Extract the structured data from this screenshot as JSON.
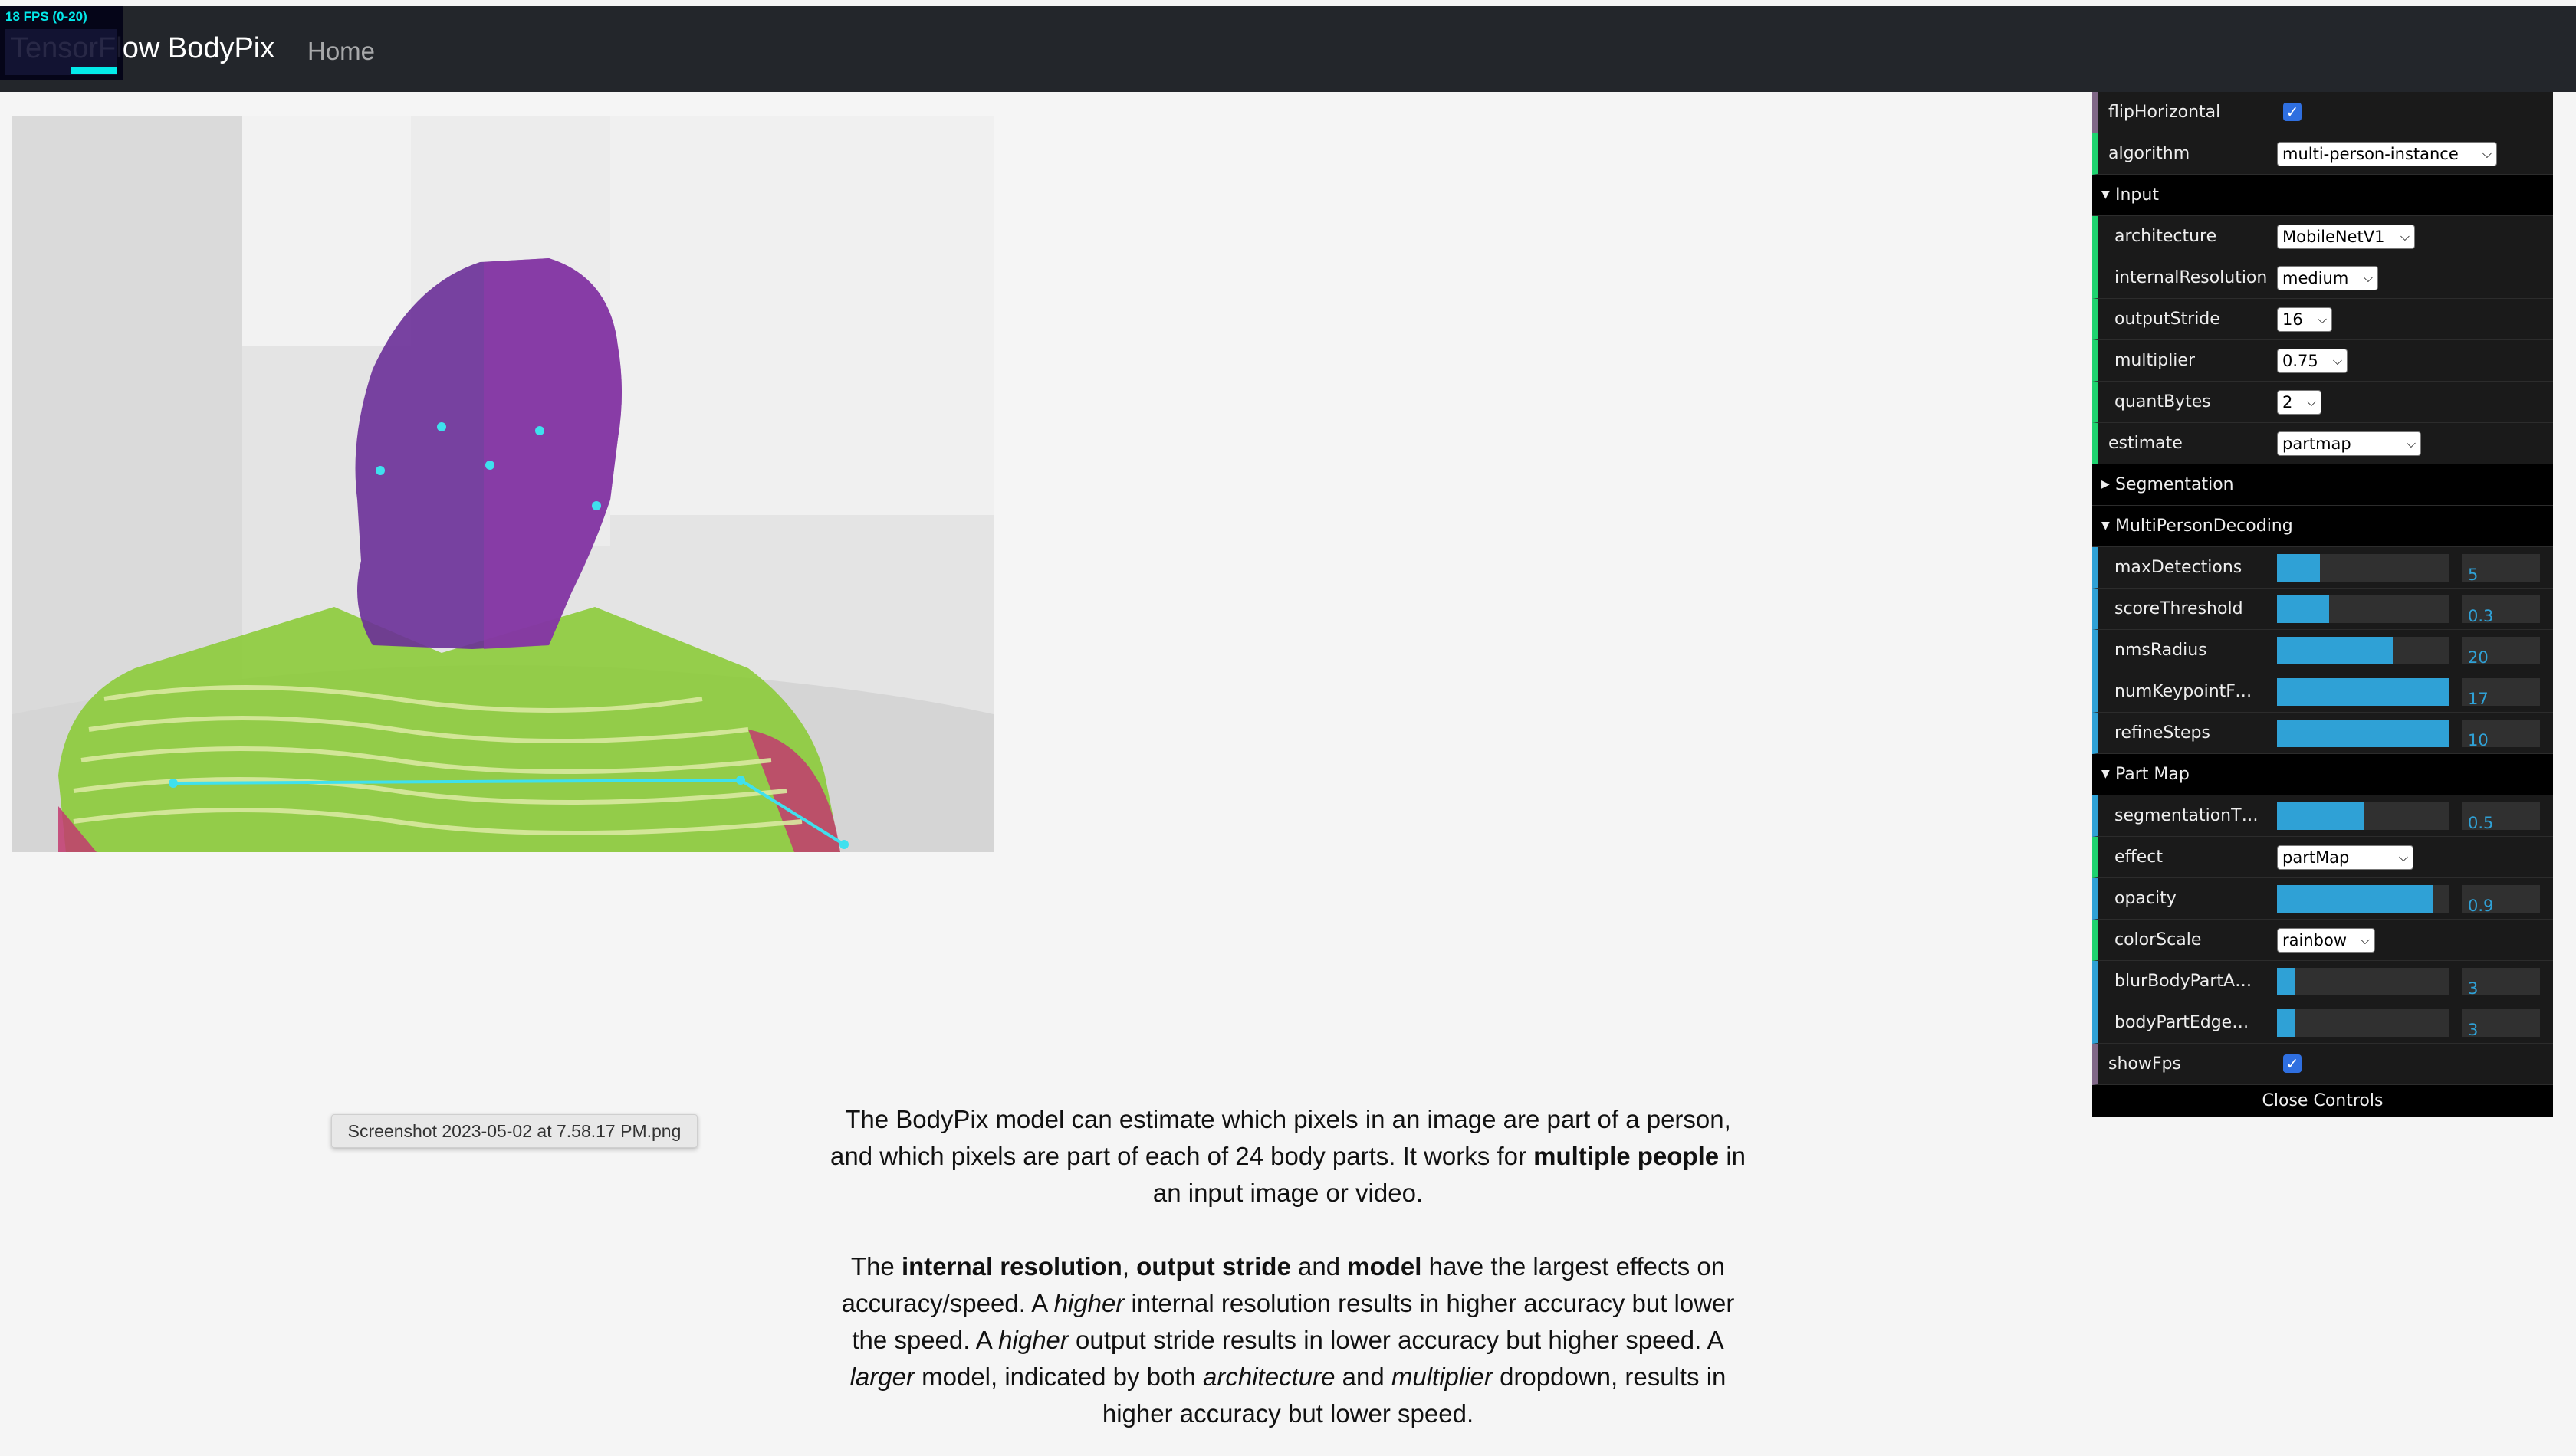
{
  "fps": {
    "text": "18 FPS (0-20)"
  },
  "navbar": {
    "brand": "TensorFlow BodyPix",
    "home": "Home"
  },
  "tooltip": "Screenshot 2023-05-02 at 7.58.17 PM.png",
  "description": {
    "p1": [
      {
        "t": "The BodyPix model can estimate which pixels in an image are part of a person, and which pixels are part of each of 24 body parts. It works for ",
        "s": ""
      },
      {
        "t": "multiple people",
        "s": "b"
      },
      {
        "t": " in an input image or video.",
        "s": ""
      }
    ],
    "p2": [
      {
        "t": "The ",
        "s": ""
      },
      {
        "t": "internal resolution",
        "s": "b"
      },
      {
        "t": ", ",
        "s": ""
      },
      {
        "t": "output stride",
        "s": "b"
      },
      {
        "t": " and ",
        "s": ""
      },
      {
        "t": "model",
        "s": "b"
      },
      {
        "t": " have the largest effects on accuracy/speed. A ",
        "s": ""
      },
      {
        "t": "higher",
        "s": "i"
      },
      {
        "t": " internal resolution results in higher accuracy but lower the speed. A ",
        "s": ""
      },
      {
        "t": "higher",
        "s": "i"
      },
      {
        "t": " output stride results in lower accuracy but higher speed. A ",
        "s": ""
      },
      {
        "t": "larger",
        "s": "i"
      },
      {
        "t": " model, indicated by both ",
        "s": ""
      },
      {
        "t": "architecture",
        "s": "i"
      },
      {
        "t": " and ",
        "s": ""
      },
      {
        "t": "multiplier",
        "s": "i"
      },
      {
        "t": " dropdown, results in higher accuracy but lower speed.",
        "s": ""
      }
    ]
  },
  "gui": {
    "flipHorizontal": {
      "label": "flipHorizontal",
      "checked": true
    },
    "algorithm": {
      "label": "algorithm",
      "value": "multi-person-instance"
    },
    "input_folder": "Input",
    "architecture": {
      "label": "architecture",
      "value": "MobileNetV1"
    },
    "internalResolution": {
      "label": "internalResolution",
      "value": "medium"
    },
    "outputStride": {
      "label": "outputStride",
      "value": "16"
    },
    "multiplier": {
      "label": "multiplier",
      "value": "0.75"
    },
    "quantBytes": {
      "label": "quantBytes",
      "value": "2"
    },
    "estimate": {
      "label": "estimate",
      "value": "partmap"
    },
    "segmentation_folder": "Segmentation",
    "mpd_folder": "MultiPersonDecoding",
    "maxDetections": {
      "label": "maxDetections",
      "value": "5",
      "fraction": 0.25
    },
    "scoreThreshold": {
      "label": "scoreThreshold",
      "value": "0.3",
      "fraction": 0.3
    },
    "nmsRadius": {
      "label": "nmsRadius",
      "value": "20",
      "fraction": 0.67
    },
    "numKeypoint": {
      "label": "numKeypointForMatching",
      "value": "17",
      "fraction": 1.0
    },
    "refineSteps": {
      "label": "refineSteps",
      "value": "10",
      "fraction": 1.0
    },
    "partmap_folder": "Part Map",
    "segmentationThreshold": {
      "label": "segmentationThreshold",
      "value": "0.5",
      "fraction": 0.5
    },
    "effect": {
      "label": "effect",
      "value": "partMap"
    },
    "opacity": {
      "label": "opacity",
      "value": "0.9",
      "fraction": 0.9
    },
    "colorScale": {
      "label": "colorScale",
      "value": "rainbow"
    },
    "blurBodyPartAmount": {
      "label": "blurBodyPartAmount",
      "value": "3",
      "fraction": 0.1
    },
    "bodyPartEdgeBlur": {
      "label": "bodyPartEdgeBlurAmount",
      "value": "3",
      "fraction": 0.1
    },
    "showFps": {
      "label": "showFps",
      "checked": true
    },
    "close": "Close Controls"
  },
  "colors": {
    "navbar": "#23262b",
    "gui_bool": "#806787",
    "gui_string": "#1ed36f",
    "gui_number": "#2fa1d6",
    "keypoint": "#3fe0ee",
    "head_part": "#6a2f98",
    "torso_part": "#8ccb3a"
  }
}
